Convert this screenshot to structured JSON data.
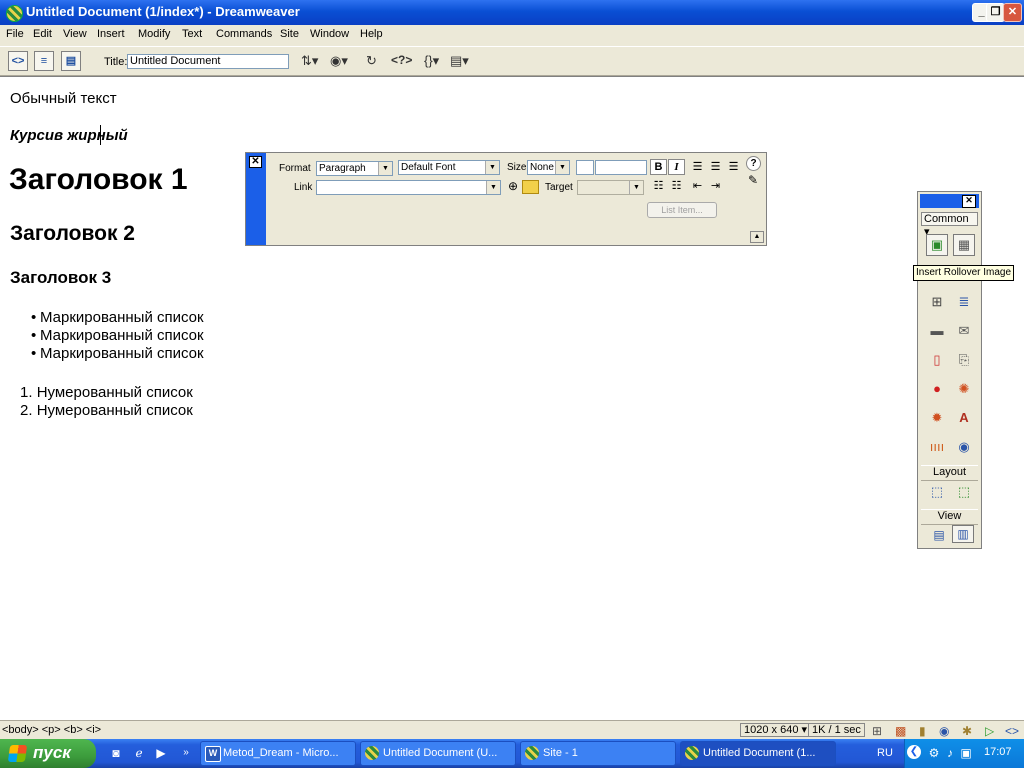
{
  "window": {
    "title": "Untitled Document (1/index*) - Dreamweaver",
    "controls": {
      "minimize": "_",
      "restore": "❐",
      "close": "✕"
    }
  },
  "menu": [
    "File",
    "Edit",
    "View",
    "Insert",
    "Modify",
    "Text",
    "Commands",
    "Site",
    "Window",
    "Help"
  ],
  "toolbar": {
    "title_label": "Title:",
    "title_value": "Untitled Document"
  },
  "document": {
    "paragraph": "Обычный текст",
    "bold_italic": "Курсив жирный",
    "heading1": "Заголовок 1",
    "heading2": "Заголовок 2",
    "heading3": "Заголовок 3",
    "bullets": [
      "Маркированный список",
      "Маркированный список",
      "Маркированный список"
    ],
    "numbered": [
      "Нумерованный список",
      "Нумерованный список"
    ],
    "numbered_markers": [
      "1.",
      "2."
    ]
  },
  "properties": {
    "format_label": "Format",
    "format_value": "Paragraph",
    "font_value": "Default Font",
    "size_label": "Size",
    "size_value": "None",
    "link_label": "Link",
    "link_value": "",
    "target_label": "Target",
    "target_value": "",
    "bold": "B",
    "italic": "I",
    "list_item_button": "List Item...",
    "help": "?"
  },
  "insert_panel": {
    "category": "Common",
    "layout_section": "Layout",
    "view_section": "View",
    "tooltip": "Insert Rollover Image"
  },
  "status": {
    "tag_selector": "<body> <p> <b> <i>",
    "window_size": "1020 x 640",
    "download": "1K / 1 sec"
  },
  "taskbar": {
    "start": "пуск",
    "tasks": [
      "Metod_Dream - Micro...",
      "Untitled Document (U...",
      "Site - 1",
      "Untitled Document (1..."
    ],
    "language": "RU",
    "time": "17:07"
  }
}
